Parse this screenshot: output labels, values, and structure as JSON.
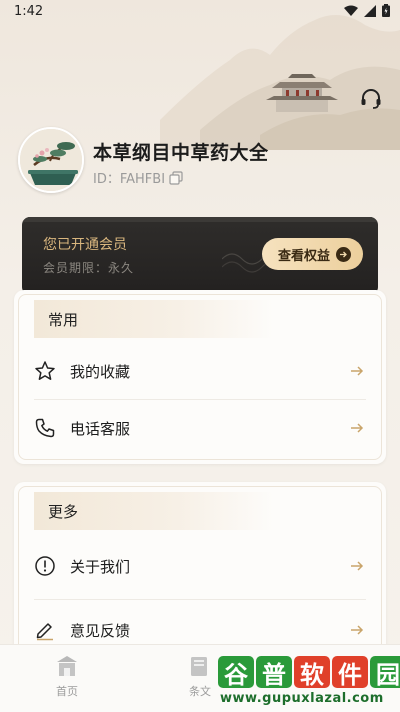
{
  "status_bar": {
    "time": "1:42"
  },
  "profile": {
    "app_title": "本草纲目中草药大全",
    "user_id": "ID：FAHFBI"
  },
  "vip": {
    "title": "您已开通会员",
    "period": "会员期限：永久",
    "button_label": "查看权益"
  },
  "sections": {
    "common": {
      "title": "常用",
      "items": [
        {
          "label": "我的收藏",
          "icon": "star-icon"
        },
        {
          "label": "电话客服",
          "icon": "phone-icon"
        }
      ]
    },
    "more": {
      "title": "更多",
      "items": [
        {
          "label": "关于我们",
          "icon": "info-icon"
        },
        {
          "label": "意见反馈",
          "icon": "pencil-icon"
        }
      ]
    }
  },
  "bottom_nav": {
    "items": [
      {
        "label": "首页",
        "icon": "home-icon"
      },
      {
        "label": "条文",
        "icon": "book-icon"
      }
    ]
  },
  "watermark": {
    "chars": [
      "谷",
      "普",
      "软",
      "件",
      "园"
    ],
    "url": "www.gupuxlazal.com"
  },
  "colors": {
    "gold": "#d9b67e",
    "vip_bg": "#2a2826",
    "accent_arrow": "#c9a46a",
    "watermark_green": "#1d8a2e"
  }
}
